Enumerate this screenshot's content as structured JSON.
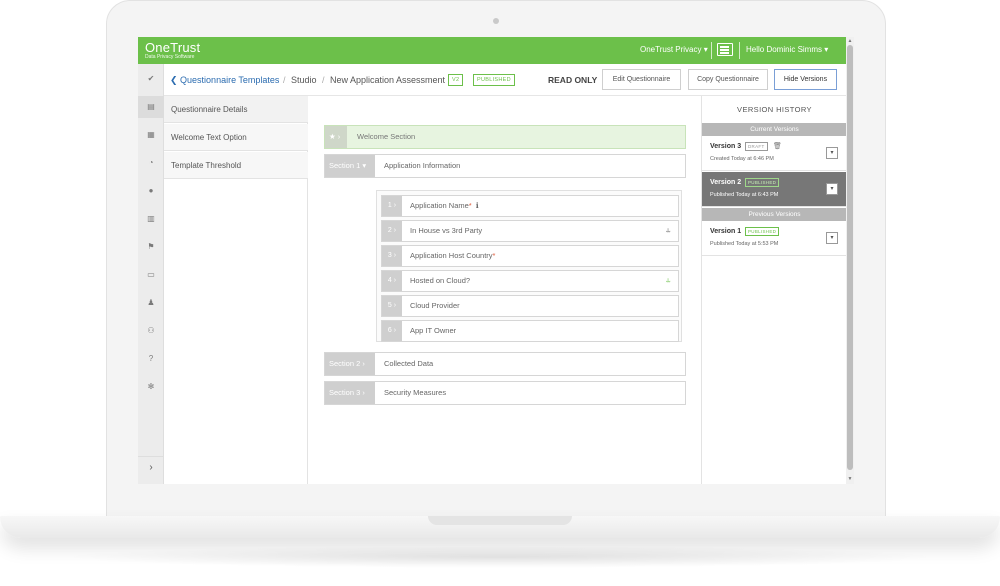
{
  "topbar": {
    "logo": "OneTrust",
    "logo_sub": "Data Privacy Software",
    "privacy_menu": "OneTrust Privacy ▾",
    "user_menu": "Hello Dominic Simms ▾",
    "accent_color": "#6cc04a"
  },
  "rail": {
    "items": [
      "check-icon",
      "document-icon",
      "grid-icon",
      "dashboard-icon",
      "globe-icon",
      "table-icon",
      "flag-icon",
      "folder-icon",
      "user-icon",
      "users-icon",
      "help-icon",
      "gear-icon"
    ],
    "expand": "›"
  },
  "breadcrumb": {
    "back": "❮ Questionnaire Templates",
    "studio": "Studio",
    "assessment": "New Application Assessment",
    "version_tag": "V2",
    "status_tag": "PUBLISHED",
    "sep": "/"
  },
  "header": {
    "read_only": "READ ONLY",
    "edit_button": "Edit Questionnaire",
    "copy_button": "Copy Questionnaire",
    "hide_button": "Hide Versions"
  },
  "leftnav": {
    "items": [
      "Questionnaire Details",
      "Welcome Text Option",
      "Template Threshold"
    ]
  },
  "main": {
    "welcome": {
      "tab": "★ ›",
      "label": "Welcome Section"
    },
    "sections": [
      {
        "tab": "Section 1 ▾",
        "label": "Application Information"
      },
      {
        "tab": "Section 2 ›",
        "label": "Collected Data"
      },
      {
        "tab": "Section 3 ›",
        "label": "Security Measures"
      }
    ],
    "questions": [
      {
        "num": "1 ›",
        "label": "Application Name",
        "required": "*",
        "icon": "ℹ"
      },
      {
        "num": "2 ›",
        "label": "In House vs 3rd Party",
        "required": "",
        "icon": "⥿"
      },
      {
        "num": "3 ›",
        "label": "Application Host Country",
        "required": "*",
        "icon": ""
      },
      {
        "num": "4 ›",
        "label": "Hosted on Cloud?",
        "required": "",
        "icon": "⥿"
      },
      {
        "num": "5 ›",
        "label": "Cloud Provider",
        "required": "",
        "icon": ""
      },
      {
        "num": "6 ›",
        "label": "App IT Owner",
        "required": "",
        "icon": ""
      }
    ]
  },
  "versions": {
    "title": "VERSION HISTORY",
    "current_label": "Current Versions",
    "previous_label": "Previous Versions",
    "items": [
      {
        "name": "Version 3",
        "badge": "DRAFT",
        "date": "Created Today at 6:46 PM"
      },
      {
        "name": "Version 2",
        "badge": "PUBLISHED",
        "date": "Published Today at 6:43 PM"
      },
      {
        "name": "Version 1",
        "badge": "PUBLISHED",
        "date": "Published Today at 5:53 PM"
      }
    ],
    "dropdown_glyph": "▾",
    "trash_glyph": "🗑"
  }
}
